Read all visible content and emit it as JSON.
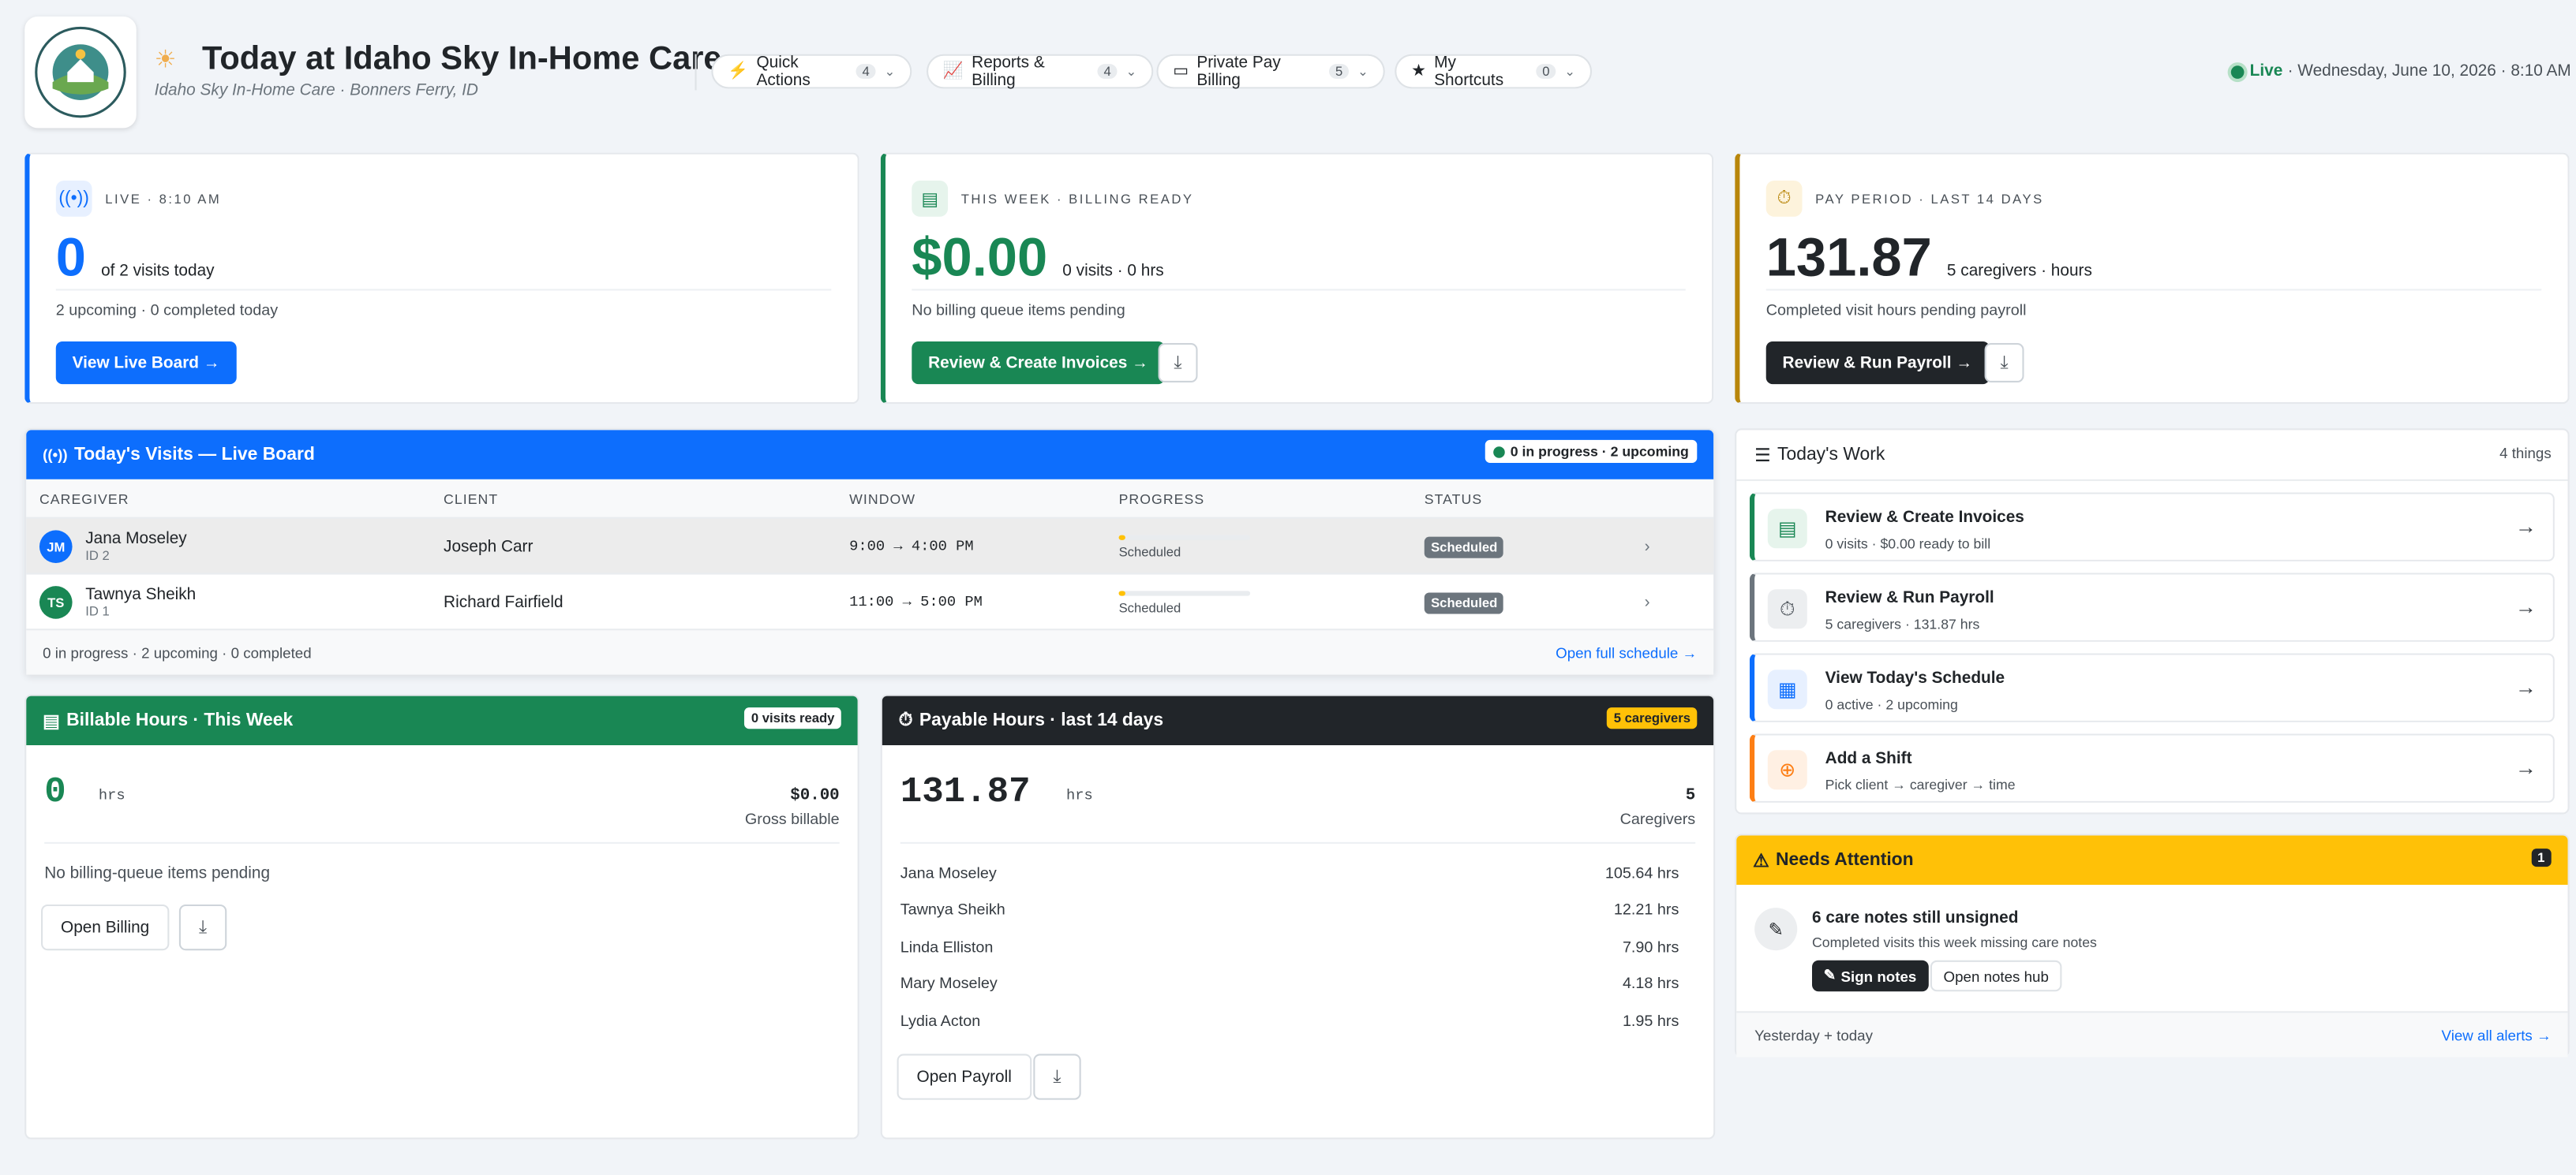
{
  "header": {
    "title": "Today at Idaho Sky In-Home Care",
    "subtitle": "Idaho Sky In-Home Care · Bonners Ferry, ID",
    "logo_text": "IDAHO SKY IN-HOME CARE",
    "status_live": "Live",
    "datetime": "· Wednesday, June 10, 2026 · 8:10 AM",
    "menus": [
      {
        "label": "Quick Actions",
        "count": "4",
        "icon": "bolt-icon"
      },
      {
        "label": "Reports & Billing",
        "count": "4",
        "icon": "chart-line-icon"
      },
      {
        "label": "Private Pay Billing",
        "count": "5",
        "icon": "wallet-icon"
      },
      {
        "label": "My Shortcuts",
        "count": "0",
        "icon": "star-icon"
      }
    ]
  },
  "kpis": {
    "live": {
      "label": "LIVE · 8:10 AM",
      "value": "0",
      "suffix": "of 2 visits today",
      "desc": "2 upcoming · 0 completed today",
      "button": "View Live Board →",
      "color": "#0d6efd"
    },
    "billing": {
      "label": "THIS WEEK · BILLING READY",
      "value": "$0.00",
      "suffix": "0 visits · 0 hrs",
      "desc": "No billing queue items pending",
      "button": "Review & Create Invoices →",
      "color": "#198754"
    },
    "payroll": {
      "label": "PAY PERIOD · LAST 14 DAYS",
      "value": "131.87",
      "suffix": "5 caregivers · hours",
      "desc": "Completed visit hours pending payroll",
      "button": "Review & Run Payroll →",
      "color": "#b8860b"
    }
  },
  "visits": {
    "title": "Today's Visits — Live Board",
    "badge": "0 in progress · 2 upcoming",
    "columns": [
      "CAREGIVER",
      "CLIENT",
      "WINDOW",
      "PROGRESS",
      "STATUS"
    ],
    "rows": [
      {
        "initials": "JM",
        "name": "Jana Moseley",
        "id": "ID 2",
        "client": "Joseph Carr",
        "window": "9:00 → 4:00 PM",
        "progress_label": "Scheduled",
        "progress": 0.05,
        "status": "Scheduled",
        "avatar_color": "#0d6efd"
      },
      {
        "initials": "TS",
        "name": "Tawnya Sheikh",
        "id": "ID 1",
        "client": "Richard Fairfield",
        "window": "11:00 → 5:00 PM",
        "progress_label": "Scheduled",
        "progress": 0.05,
        "status": "Scheduled",
        "avatar_color": "#198754"
      }
    ],
    "footer": "0 in progress · 2 upcoming · 0 completed",
    "footer_link": "Open full schedule →"
  },
  "billable": {
    "title": "Billable Hours · This Week",
    "badge": "0 visits ready",
    "hours": "0",
    "unit": "hrs",
    "amount": "$0.00",
    "amount_label": "Gross billable",
    "empty": "No billing-queue items pending",
    "button": "Open Billing"
  },
  "payable": {
    "title": "Payable Hours · last 14 days",
    "badge": "5 caregivers",
    "hours": "131.87",
    "unit": "hrs",
    "count": "5",
    "count_label": "Caregivers",
    "rows": [
      {
        "name": "Jana Moseley",
        "hours": "105.64 hrs"
      },
      {
        "name": "Tawnya Sheikh",
        "hours": "12.21 hrs"
      },
      {
        "name": "Linda Elliston",
        "hours": "7.90 hrs"
      },
      {
        "name": "Mary Moseley",
        "hours": "4.18 hrs"
      },
      {
        "name": "Lydia Acton",
        "hours": "1.95 hrs"
      }
    ],
    "button": "Open Payroll"
  },
  "work": {
    "title": "Today's Work",
    "count": "4 things",
    "items": [
      {
        "title": "Review & Create Invoices",
        "sub": "0 visits · $0.00 ready to bill",
        "color": "#198754"
      },
      {
        "title": "Review & Run Payroll",
        "sub": "5 caregivers · 131.87 hrs",
        "color": "#6c757d"
      },
      {
        "title": "View Today's Schedule",
        "sub": "0 active · 2 upcoming",
        "color": "#0d6efd"
      },
      {
        "title": "Add a Shift",
        "sub": "Pick client → caregiver → time",
        "color": "#fd7e14"
      }
    ]
  },
  "attention": {
    "title": "Needs Attention",
    "count": "1",
    "item_title": "6 care notes still unsigned",
    "item_sub": "Completed visits this week missing care notes",
    "btn_primary": "Sign notes",
    "btn_secondary": "Open notes hub",
    "footer": "Yesterday + today",
    "footer_link": "View all alerts →"
  }
}
